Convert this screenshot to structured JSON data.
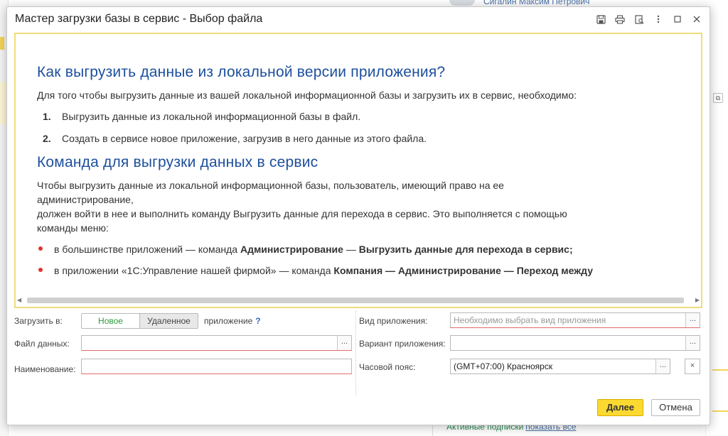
{
  "background": {
    "user_name": "Сигалин Максим Петрович",
    "subscriptions_label": "Активные подписки",
    "show_all_link": "показать все"
  },
  "dialog": {
    "title": "Мастер загрузки базы в сервис - Выбор файла",
    "title_icons": [
      "save-icon",
      "print-icon",
      "preview-icon",
      "more-icon",
      "maximize-icon",
      "close-icon"
    ]
  },
  "help": {
    "heading1": "Как выгрузить данные из локальной версии приложения?",
    "intro": "Для того чтобы выгрузить данные из вашей локальной информационной базы и загрузить их в сервис, необходимо:",
    "steps": [
      {
        "num": "1.",
        "text": "Выгрузить данные из локальной информационной базы в файл."
      },
      {
        "num": "2.",
        "text": "Создать в сервисе новое приложение, загрузив в него данные из этого файла."
      }
    ],
    "heading2": "Команда для выгрузки данных в сервис",
    "para1": "Чтобы выгрузить данные из локальной информационной базы, пользователь, имеющий право на ее администрирование,",
    "para1_line1": "Чтобы выгрузить данные из локальной информационной базы, пользователь, имеющий право на ее",
    "para1_line2": "администрирование,",
    "para2_line1": "должен войти в нее и выполнить команду Выгрузить данные для перехода в сервис. Это выполняется с помощью",
    "para2_line2": "команды меню:",
    "bullet1_pre": "в большинстве приложений — команда ",
    "bullet1_b1": "Администрирование",
    "bullet1_mid": " — ",
    "bullet1_b2": "Выгрузить данные для перехода в сервис;",
    "bullet2_pre": "в приложении «1С:Управление нашей фирмой» — команда ",
    "bullet2_b": "Компания — Администрирование — Переход между"
  },
  "form": {
    "upload_to_label": "Загрузить в:",
    "new_option": "Новое",
    "remote_option": "Удаленное",
    "app_suffix": "приложение",
    "help_mark": "?",
    "data_file_label": "Файл данных:",
    "data_file_value": "",
    "name_label": "Наименование:",
    "name_value": "",
    "app_kind_label": "Вид приложения:",
    "app_kind_placeholder": "Необходимо выбрать вид приложения",
    "app_variant_label": "Вариант приложения:",
    "app_variant_value": "",
    "timezone_label": "Часовой пояс:",
    "timezone_value": "(GMT+07:00) Красноярск",
    "choose_btn": "...",
    "clear_btn": "×"
  },
  "buttons": {
    "next": "Далее",
    "cancel": "Отмена"
  },
  "colors": {
    "accent": "#fbd930",
    "heading": "#1c4f9c",
    "bullet": "#e0332e",
    "new_option": "#2b9a3d"
  }
}
